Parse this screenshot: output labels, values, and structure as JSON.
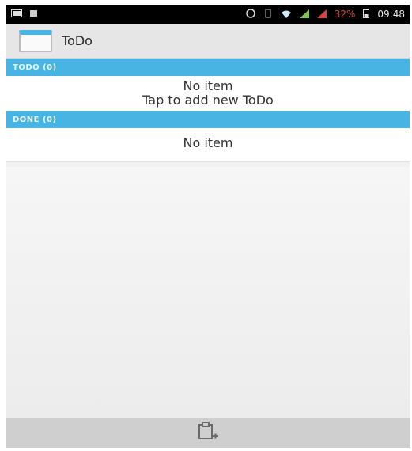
{
  "status_bar": {
    "battery_percent": "32%",
    "time": "09:48",
    "icons": [
      "screen-icon",
      "notification-icon",
      "alarm-icon",
      "wifi-icon",
      "signal-icon",
      "battery-icon"
    ]
  },
  "action_bar": {
    "title": "ToDo",
    "icon": "app-icon"
  },
  "todo_section": {
    "header": "TODO (0)",
    "empty_text": "No item",
    "hint_text": "Tap to add new ToDo"
  },
  "done_section": {
    "header": "DONE (0)",
    "empty_text": "No item"
  },
  "bottom_bar": {
    "button_icon": "add-todo-icon"
  },
  "colors": {
    "accent": "#47b4e4",
    "action_bar": "#e6e6e6",
    "bottom_bar": "#cfcfcf",
    "status_bar": "#000000",
    "battery_text": "#d94343"
  }
}
